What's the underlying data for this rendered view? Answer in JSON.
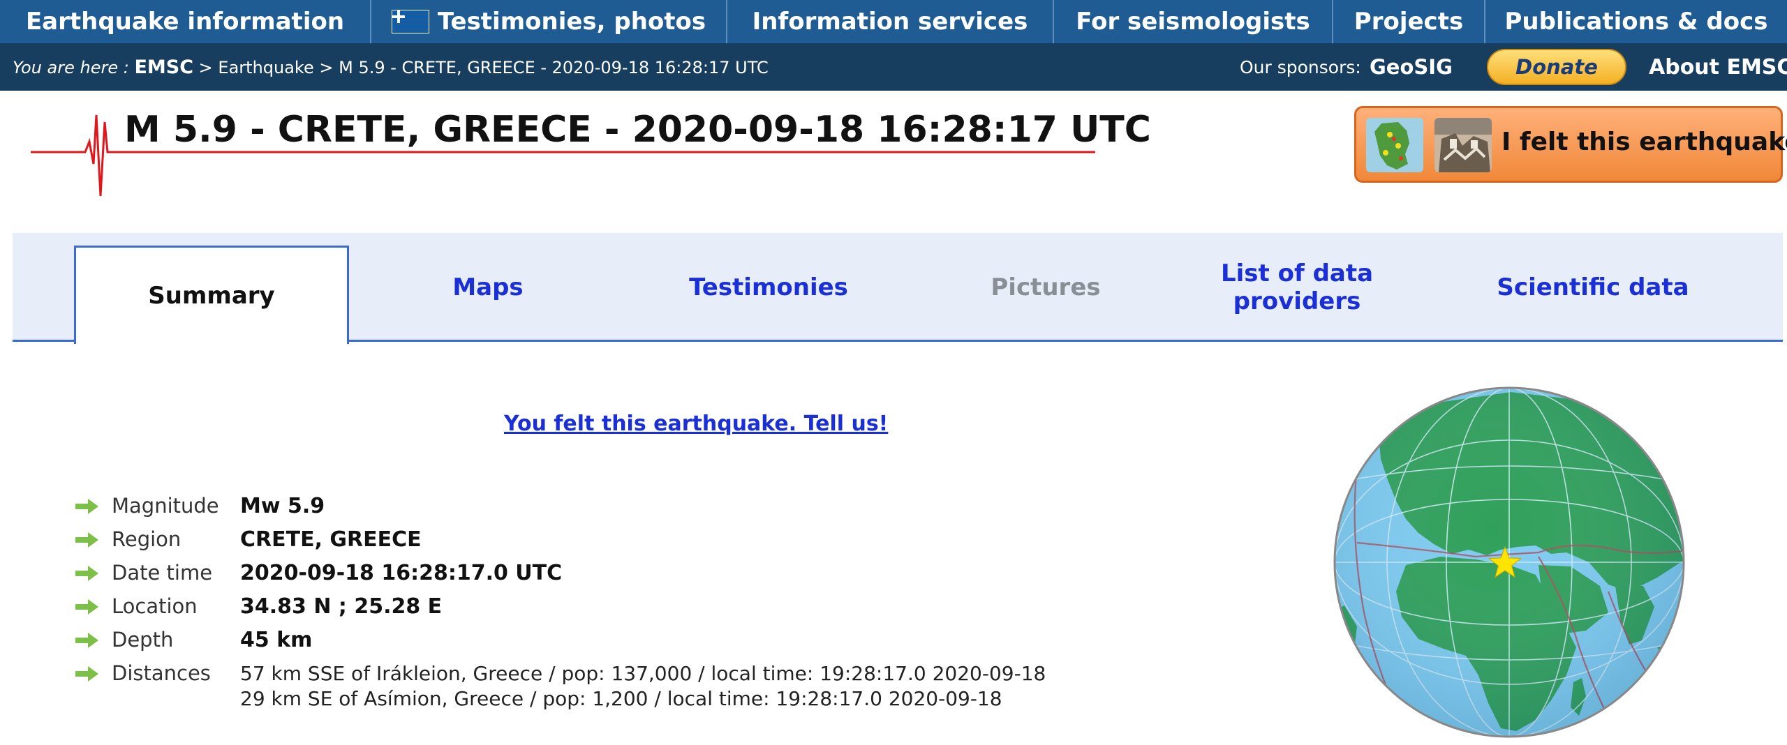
{
  "topnav": {
    "items": [
      {
        "label": "Earthquake information"
      },
      {
        "label": "Testimonies, photos"
      },
      {
        "label": "Information services"
      },
      {
        "label": "For seismologists"
      },
      {
        "label": "Projects"
      },
      {
        "label": "Publications & docs"
      }
    ]
  },
  "breadcrumb": {
    "prefix": "You are here : ",
    "root": "EMSC",
    "path": " > Earthquake > M 5.9 - CRETE, GREECE - 2020-09-18 16:28:17 UTC"
  },
  "sponsors": {
    "label": "Our sponsors:",
    "name": "GeoSIG"
  },
  "donate_label": "Donate",
  "about_label": "About EMSC",
  "title": "M 5.9 - CRETE, GREECE - 2020-09-18 16:28:17 UTC",
  "felt_button_label": "I felt this earthquake",
  "tabs": [
    {
      "label": "Summary"
    },
    {
      "label": "Maps"
    },
    {
      "label": "Testimonies"
    },
    {
      "label": "Pictures"
    },
    {
      "label": "List of data providers"
    },
    {
      "label": "Scientific data"
    }
  ],
  "felt_link": "You felt this earthquake. Tell us!",
  "details": {
    "magnitude": {
      "label": "Magnitude",
      "value": "Mw 5.9"
    },
    "region": {
      "label": "Region",
      "value": "CRETE, GREECE"
    },
    "datetime": {
      "label": "Date time",
      "value": "2020-09-18 16:28:17.0 UTC"
    },
    "location": {
      "label": "Location",
      "value": "34.83 N ; 25.28 E"
    },
    "depth": {
      "label": "Depth",
      "value": "45 km"
    },
    "distances": {
      "label": "Distances",
      "lines": [
        "57 km SSE of Irákleion, Greece / pop: 137,000 / local time: 19:28:17.0 2020-09-18",
        "29 km SE of Asímion, Greece / pop: 1,200 / local time: 19:28:17.0 2020-09-18"
      ]
    }
  },
  "colors": {
    "nav": "#1f5c93",
    "breadcrumb_bar": "#173e5e",
    "tab_strip": "#e7eef9",
    "link": "#1a2fd6",
    "felt_button": "#f08838",
    "globe_ocean": "#7ecbf0",
    "globe_land": "#2fa05a",
    "epicenter_star": "#ffe400"
  }
}
